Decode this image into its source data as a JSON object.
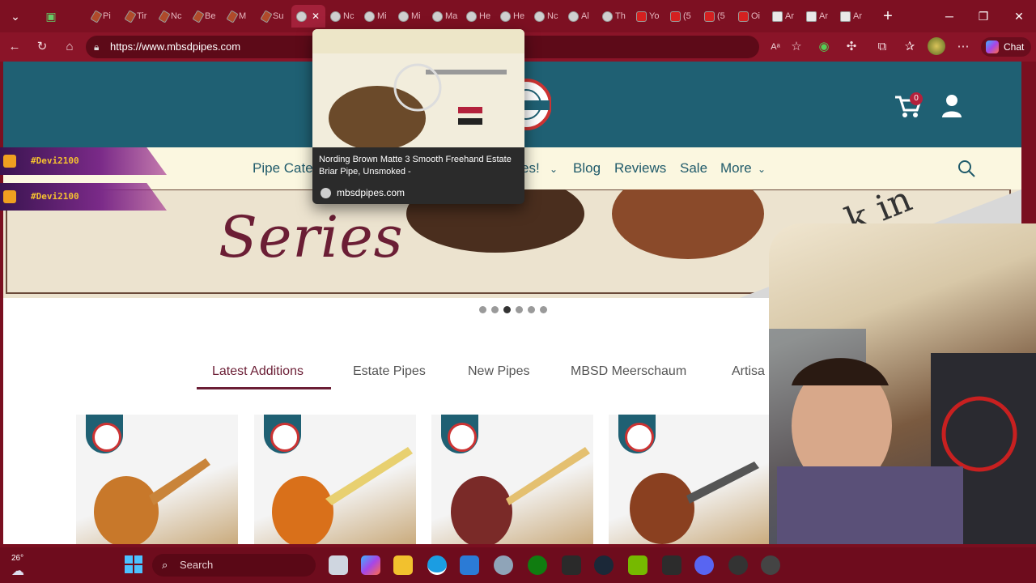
{
  "browser": {
    "tabs": [
      {
        "label": "Pi",
        "icon": "pipe-favicon"
      },
      {
        "label": "Tir",
        "icon": "pipe-favicon"
      },
      {
        "label": "Nc",
        "icon": "pipe-favicon"
      },
      {
        "label": "Be",
        "icon": "pipe-favicon"
      },
      {
        "label": "M",
        "icon": "pipe-favicon"
      },
      {
        "label": "Su",
        "icon": "pipe-favicon"
      },
      {
        "label": "",
        "icon": "mbsd-favicon",
        "active": true
      },
      {
        "label": "Nc",
        "icon": "mbsd-favicon"
      },
      {
        "label": "Mi",
        "icon": "mbsd-favicon"
      },
      {
        "label": "Mi",
        "icon": "mbsd-favicon"
      },
      {
        "label": "Ma",
        "icon": "mbsd-favicon"
      },
      {
        "label": "He",
        "icon": "mbsd-favicon"
      },
      {
        "label": "He",
        "icon": "mbsd-favicon"
      },
      {
        "label": "Nc",
        "icon": "mbsd-favicon"
      },
      {
        "label": "Al",
        "icon": "mbsd-favicon"
      },
      {
        "label": "Th",
        "icon": "mbsd-favicon"
      },
      {
        "label": "Yo",
        "icon": "youtube-favicon"
      },
      {
        "label": "(5",
        "icon": "youtube-favicon"
      },
      {
        "label": "(5",
        "icon": "youtube-favicon"
      },
      {
        "label": "Oi",
        "icon": "youtube-favicon"
      },
      {
        "label": "Ar",
        "icon": "doc-favicon"
      },
      {
        "label": "Ar",
        "icon": "doc-favicon"
      },
      {
        "label": "Ar",
        "icon": "doc-favicon"
      }
    ],
    "url": "https://www.mbsdpipes.com",
    "chat_label": "Chat"
  },
  "hover_card": {
    "title": "Nording Brown Matte 3 Smooth Freehand Estate Briar Pipe, Unsmoked -",
    "site": "mbsdpipes.com"
  },
  "site": {
    "cart_count": "0",
    "nav": [
      "Pipe Cate",
      "es!",
      "Blog",
      "Reviews",
      "Sale",
      "More"
    ],
    "banner_text": "Series",
    "banner_partial": "k in",
    "category_tabs": [
      "Latest Additions",
      "Estate Pipes",
      "New Pipes",
      "MBSD Meerschaum",
      "Artisa"
    ],
    "selected_tab": "Latest Additions",
    "carousel_dots": 6,
    "carousel_active": 3
  },
  "overlays": {
    "stream_tag_1": "#Devi2100",
    "stream_tag_2": "#Devi2100"
  },
  "taskbar": {
    "temperature": "26°",
    "search_label": "Search"
  },
  "colors": {
    "browser_frame": "#7d1022",
    "site_header": "#1f6073",
    "nav_bg": "#fbf7e0",
    "accent": "#6b1e35"
  }
}
